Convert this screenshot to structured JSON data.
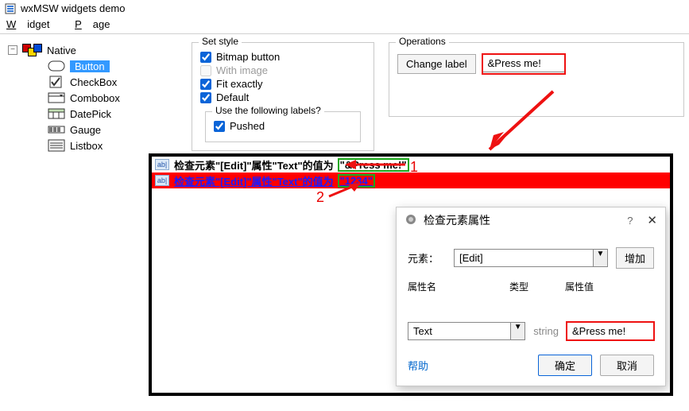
{
  "window": {
    "title": "wxMSW widgets demo"
  },
  "menu": {
    "widget": "Widget",
    "page": "Page"
  },
  "tree": {
    "root": "Native",
    "items": [
      "Button",
      "CheckBox",
      "Combobox",
      "DatePick",
      "Gauge",
      "Listbox"
    ]
  },
  "style_group": {
    "title": "Set style",
    "bitmap": "Bitmap button",
    "with_image": "With image",
    "fit": "Fit exactly",
    "default": "Default"
  },
  "labels_group": {
    "title": "Use the following labels?",
    "pushed": "Pushed"
  },
  "ops": {
    "title": "Operations",
    "change_label": "Change label",
    "value": "&Press me!"
  },
  "overlay": {
    "row1_prefix": "检查元素\"[Edit]\"属性\"Text\"的值为",
    "row1_value": "\"&Press me!\"",
    "row2_prefix": "检查元素\"[Edit]\"属性\"Text\"的值为",
    "row2_value": "\"1234\"",
    "anno1": "1",
    "anno2": "2"
  },
  "dialog": {
    "title": "检查元素属性",
    "element_label": "元素：",
    "element_value": "[Edit]",
    "add": "增加",
    "col_name": "属性名",
    "col_type": "类型",
    "col_value": "属性值",
    "prop_name": "Text",
    "prop_type": "string",
    "prop_value": "&Press me!",
    "help": "帮助",
    "ok": "确定",
    "cancel": "取消"
  }
}
